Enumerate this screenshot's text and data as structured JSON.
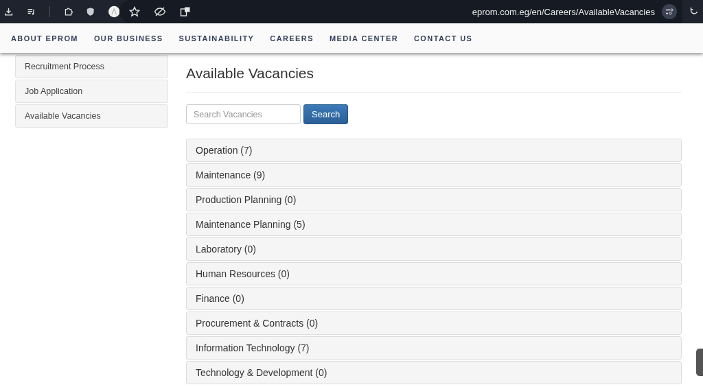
{
  "browser": {
    "url": "eprom.com.eg/en/Careers/AvailableVacancies"
  },
  "nav": [
    "ABOUT EPROM",
    "OUR BUSINESS",
    "SUSTAINABILITY",
    "CAREERS",
    "MEDIA CENTER",
    "CONTACT US"
  ],
  "sidebar": {
    "items": [
      "Recruitment Process",
      "Job Application",
      "Available Vacancies"
    ]
  },
  "main": {
    "title": "Available Vacancies",
    "search": {
      "placeholder": "Search Vacancies",
      "button": "Search"
    },
    "categories": [
      "Operation (7)",
      "Maintenance (9)",
      "Production Planning (0)",
      "Maintenance Planning (5)",
      "Laboratory (0)",
      "Human Resources (0)",
      "Finance (0)",
      "Procurement & Contracts (0)",
      "Information Technology (7)",
      "Technology & Development (0)"
    ]
  }
}
